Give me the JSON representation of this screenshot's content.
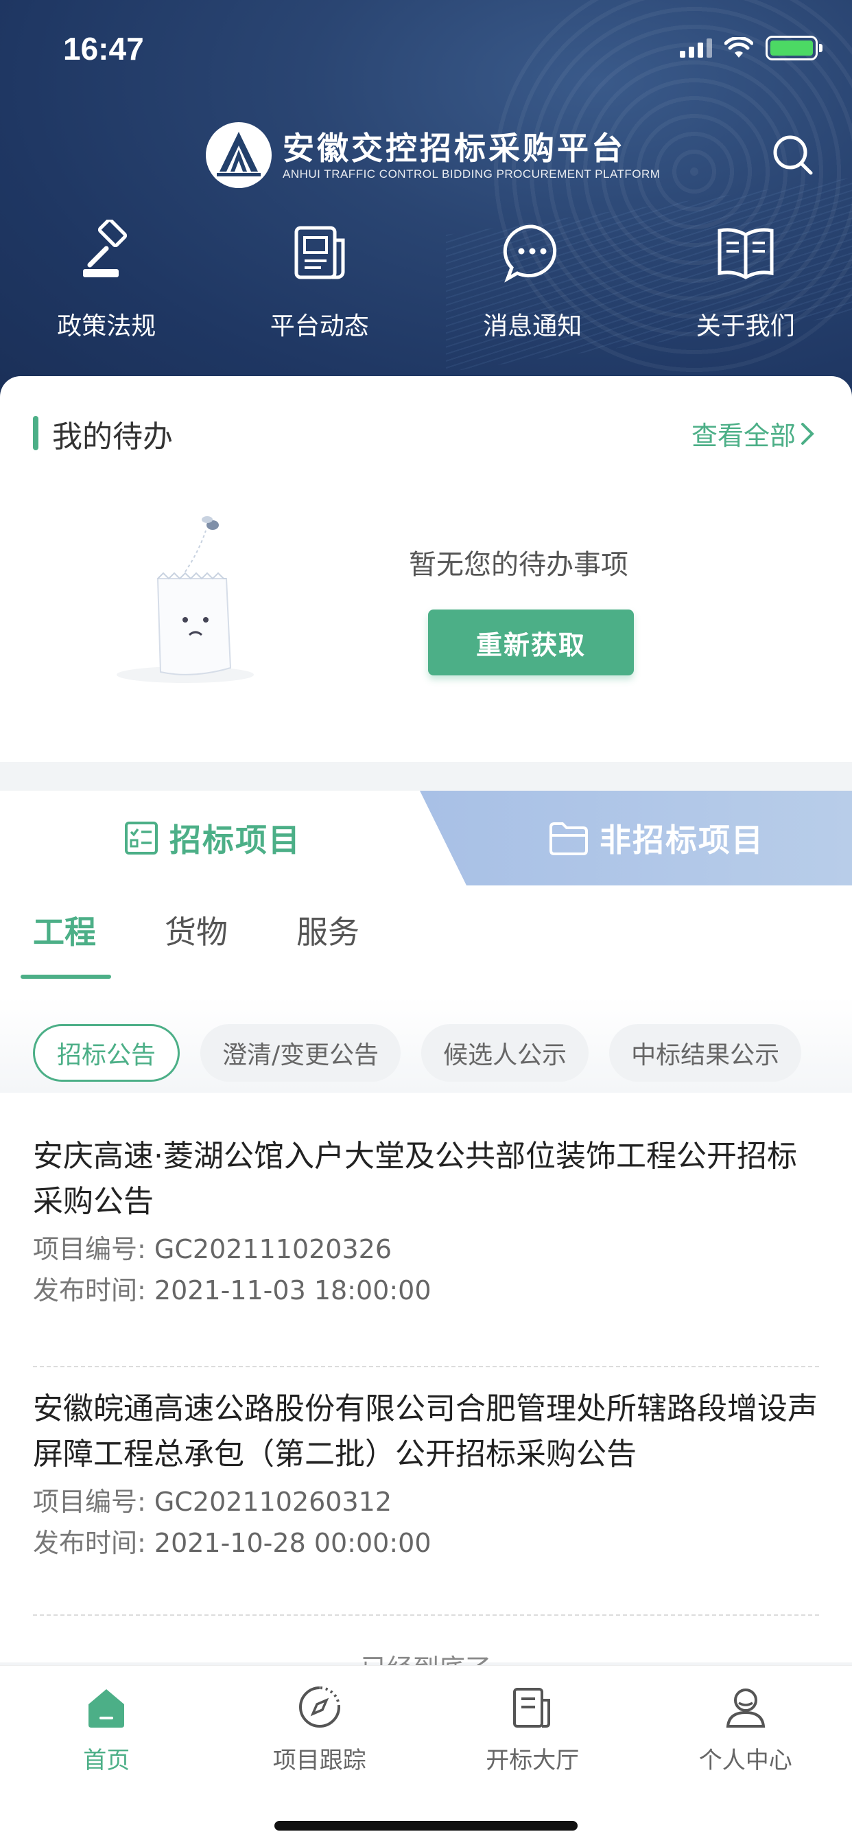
{
  "status_bar": {
    "time": "16:47"
  },
  "header": {
    "title": "安徽交控招标采购平台",
    "subtitle": "ANHUI TRAFFIC CONTROL BIDDING PROCUREMENT PLATFORM",
    "nav": [
      {
        "label": "政策法规",
        "icon": "gavel-icon"
      },
      {
        "label": "平台动态",
        "icon": "newspaper-icon"
      },
      {
        "label": "消息通知",
        "icon": "chat-bubble-icon"
      },
      {
        "label": "关于我们",
        "icon": "open-book-icon"
      }
    ]
  },
  "todo": {
    "title": "我的待办",
    "see_all": "查看全部",
    "empty_text": "暂无您的待办事项",
    "refresh_label": "重新获取"
  },
  "projects": {
    "segments": [
      {
        "label": "招标项目",
        "active": true
      },
      {
        "label": "非招标项目",
        "active": false
      }
    ],
    "subtabs": [
      {
        "label": "工程",
        "active": true
      },
      {
        "label": "货物",
        "active": false
      },
      {
        "label": "服务",
        "active": false
      }
    ],
    "chips": [
      {
        "label": "招标公告",
        "active": true
      },
      {
        "label": "澄清/变更公告",
        "active": false
      },
      {
        "label": "候选人公示",
        "active": false
      },
      {
        "label": "中标结果公示",
        "active": false
      }
    ],
    "items": [
      {
        "title": "安庆高速·菱湖公馆入户大堂及公共部位装饰工程公开招标采购公告",
        "code_label": "项目编号:",
        "code": "GC202111020326",
        "time_label": "发布时间:",
        "time": "2021-11-03 18:00:00"
      },
      {
        "title": "安徽皖通高速公路股份有限公司合肥管理处所辖路段增设声屏障工程总承包（第二批）公开招标采购公告",
        "code_label": "项目编号:",
        "code": "GC202110260312",
        "time_label": "发布时间:",
        "time": "2021-10-28 00:00:00"
      }
    ],
    "end_text": "已经到底了"
  },
  "tabbar": [
    {
      "label": "首页",
      "icon": "home-icon",
      "active": true
    },
    {
      "label": "项目跟踪",
      "icon": "tracking-icon",
      "active": false
    },
    {
      "label": "开标大厅",
      "icon": "hall-icon",
      "active": false
    },
    {
      "label": "个人中心",
      "icon": "person-icon",
      "active": false
    }
  ],
  "colors": {
    "accent": "#4caf87",
    "header_bg": "#23406b",
    "segment_inactive": "#a8c0e6"
  }
}
